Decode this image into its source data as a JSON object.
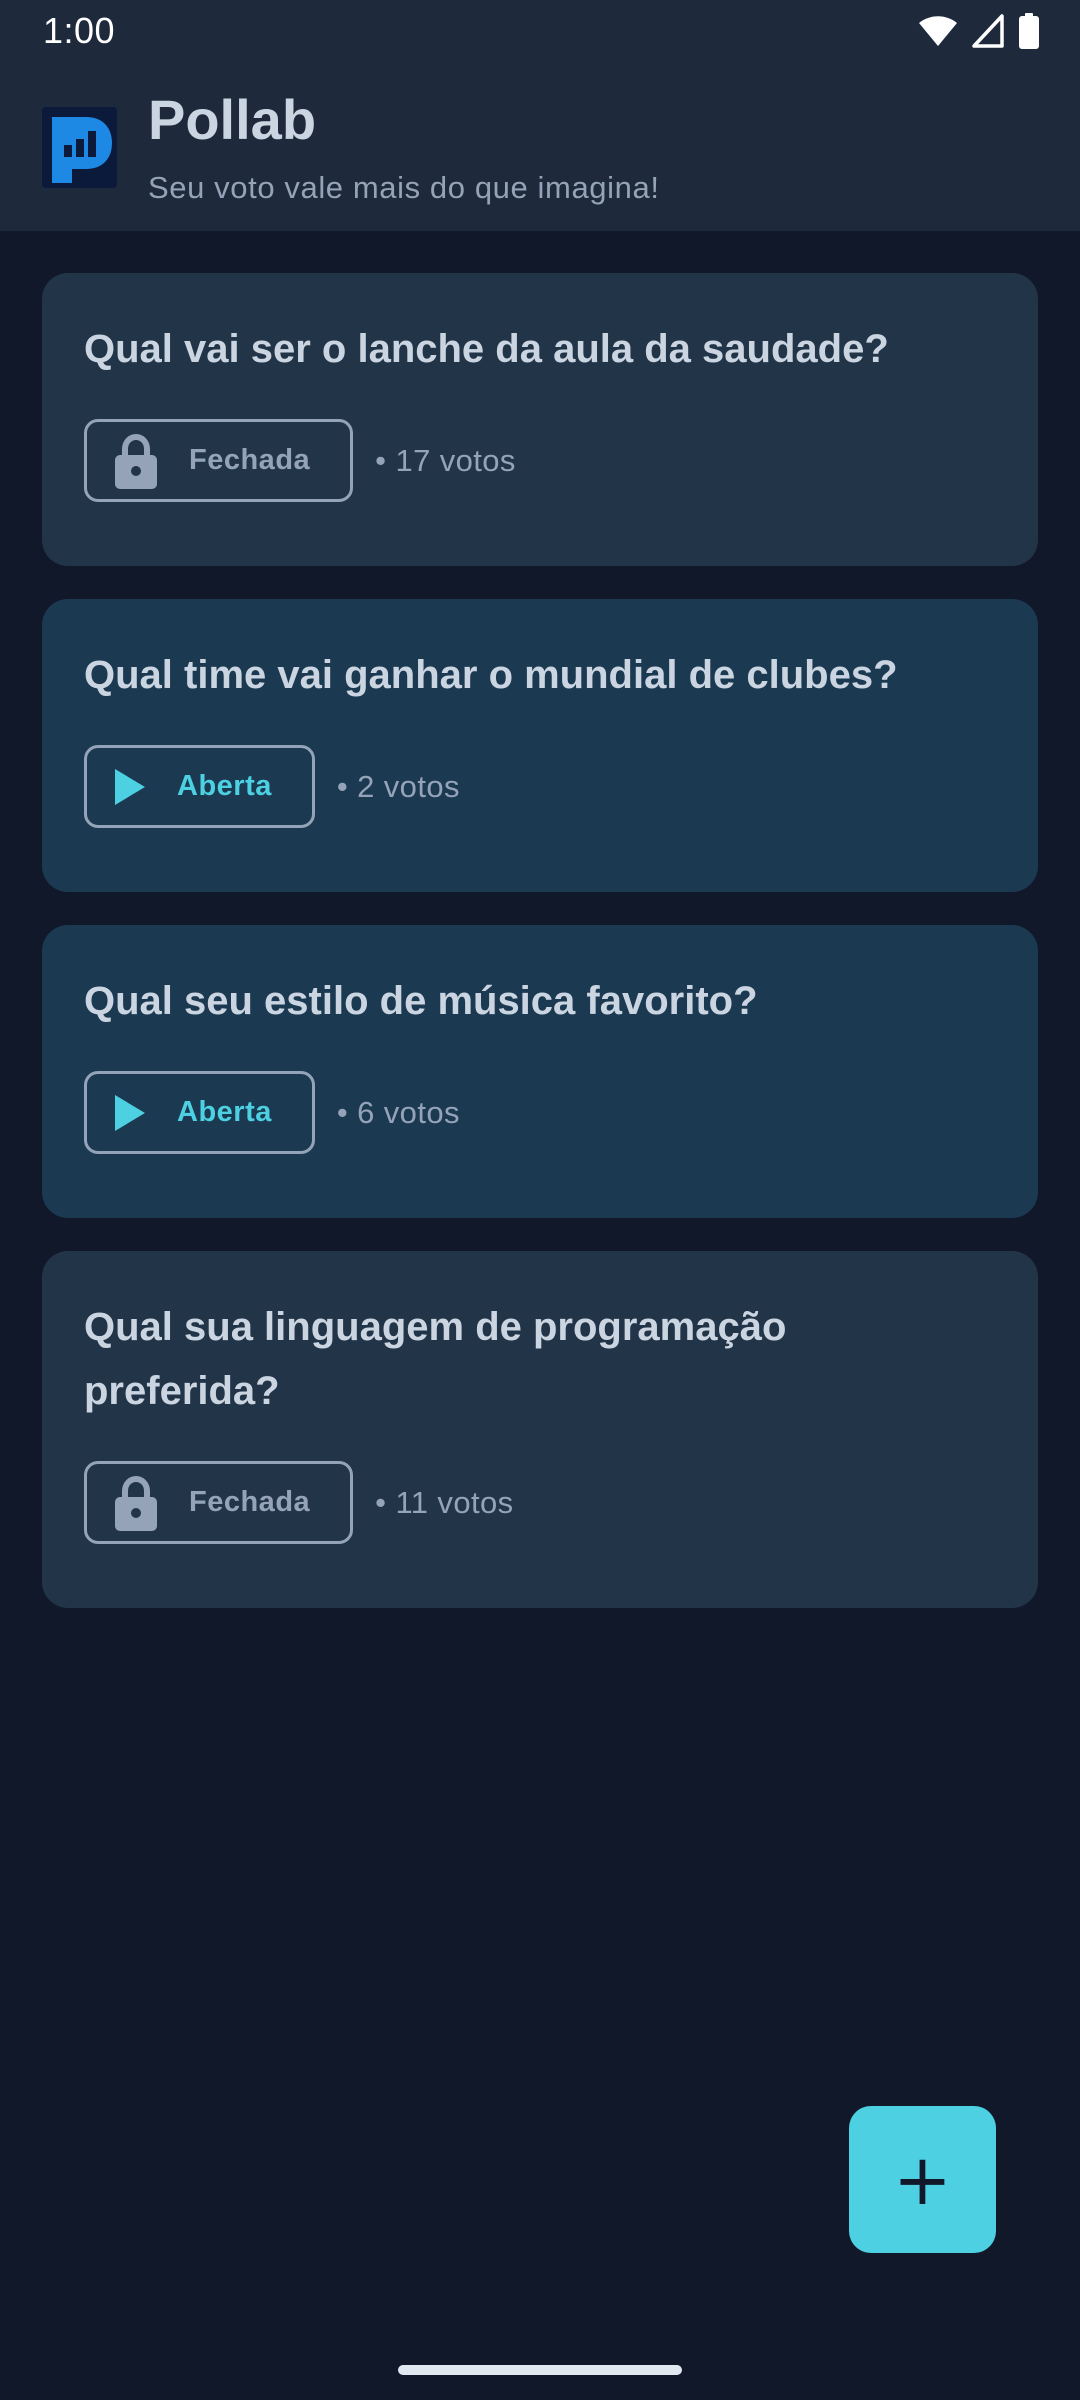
{
  "status_bar": {
    "time": "1:00",
    "icons": [
      "wifi-icon",
      "signal-icon",
      "battery-icon"
    ]
  },
  "app": {
    "title": "Pollab",
    "subtitle": "Seu voto vale mais do que imagina!",
    "logo_icon": "pollab-logo-icon"
  },
  "polls": [
    {
      "question": "Qual vai ser o lanche da aula da saudade?",
      "status": "Fechada",
      "status_icon": "lock-icon",
      "votes": "• 17 votos"
    },
    {
      "question": "Qual time vai ganhar o mundial de clubes?",
      "status": "Aberta",
      "status_icon": "play-icon",
      "votes": "• 2 votos"
    },
    {
      "question": "Qual seu estilo de música favorito?",
      "status": "Aberta",
      "status_icon": "play-icon",
      "votes": "• 6 votos"
    },
    {
      "question": "Qual sua linguagem de programação preferida?",
      "status": "Fechada",
      "status_icon": "lock-icon",
      "votes": "• 11 votos"
    }
  ],
  "fab": {
    "icon": "plus-icon",
    "symbol": "+"
  },
  "colors": {
    "background": "#10182a",
    "header": "#1e293b",
    "card_closed": "#223447",
    "card_open": "#1b3a52",
    "accent": "#4dd0e1",
    "muted": "#94a3b8"
  }
}
